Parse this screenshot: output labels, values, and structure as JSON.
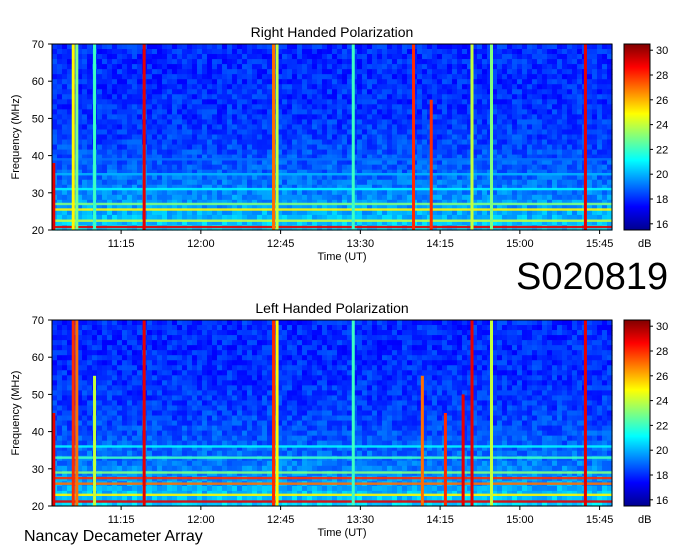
{
  "dataset_code": "S020819",
  "instrument": "Nancay Decameter Array",
  "colorbar": {
    "unit": "dB",
    "range": [
      15.5,
      30.5
    ],
    "ticks": [
      "16",
      "18",
      "20",
      "22",
      "24",
      "26",
      "28",
      "30"
    ]
  },
  "chart_data": [
    {
      "type": "heatmap",
      "title": "Right Handed Polarization",
      "xlabel": "Time (UT)",
      "ylabel": "Frequency (MHz)",
      "xlim": [
        "10:36",
        "15:52"
      ],
      "ylim": [
        20,
        70
      ],
      "x_ticks": [
        "11:15",
        "12:00",
        "12:45",
        "13:30",
        "14:15",
        "15:00",
        "15:45"
      ],
      "y_ticks": [
        "20",
        "30",
        "40",
        "50",
        "60",
        "70"
      ],
      "z_unit": "dB",
      "z_range": [
        15.5,
        30.5
      ],
      "bursts": [
        {
          "time": "10:37",
          "f_low": 20,
          "f_high": 38,
          "level_db": 29
        },
        {
          "time": "10:48",
          "f_low": 20,
          "f_high": 70,
          "level_db": 25
        },
        {
          "time": "10:50",
          "f_low": 20,
          "f_high": 70,
          "level_db": 23
        },
        {
          "time": "11:00",
          "f_low": 20,
          "f_high": 70,
          "level_db": 22
        },
        {
          "time": "11:28",
          "f_low": 20,
          "f_high": 70,
          "level_db": 29
        },
        {
          "time": "12:41",
          "f_low": 20,
          "f_high": 70,
          "level_db": 27
        },
        {
          "time": "12:43",
          "f_low": 20,
          "f_high": 70,
          "level_db": 24
        },
        {
          "time": "13:26",
          "f_low": 20,
          "f_high": 70,
          "level_db": 22
        },
        {
          "time": "14:00",
          "f_low": 20,
          "f_high": 70,
          "level_db": 28
        },
        {
          "time": "14:10",
          "f_low": 20,
          "f_high": 55,
          "level_db": 28
        },
        {
          "time": "14:33",
          "f_low": 20,
          "f_high": 70,
          "level_db": 24
        },
        {
          "time": "14:44",
          "f_low": 20,
          "f_high": 70,
          "level_db": 23
        },
        {
          "time": "15:37",
          "f_low": 20,
          "f_high": 70,
          "level_db": 29
        }
      ],
      "bands": [
        {
          "freq": 20.8,
          "level_db": 29
        },
        {
          "freq": 22.5,
          "level_db": 24
        },
        {
          "freq": 25.5,
          "level_db": 25
        },
        {
          "freq": 27,
          "level_db": 23
        },
        {
          "freq": 31,
          "level_db": 21
        },
        {
          "freq": 35,
          "level_db": 20
        },
        {
          "freq": 39,
          "level_db": 19
        }
      ]
    },
    {
      "type": "heatmap",
      "title": "Left Handed Polarization",
      "xlabel": "Time (UT)",
      "ylabel": "Frequency (MHz)",
      "xlim": [
        "10:36",
        "15:52"
      ],
      "ylim": [
        20,
        70
      ],
      "x_ticks": [
        "11:15",
        "12:00",
        "12:45",
        "13:30",
        "14:15",
        "15:00",
        "15:45"
      ],
      "y_ticks": [
        "20",
        "30",
        "40",
        "50",
        "60",
        "70"
      ],
      "z_unit": "dB",
      "z_range": [
        15.5,
        30.5
      ],
      "bursts": [
        {
          "time": "10:37",
          "f_low": 20,
          "f_high": 45,
          "level_db": 29
        },
        {
          "time": "10:48",
          "f_low": 20,
          "f_high": 70,
          "level_db": 28
        },
        {
          "time": "10:50",
          "f_low": 20,
          "f_high": 70,
          "level_db": 27
        },
        {
          "time": "11:00",
          "f_low": 20,
          "f_high": 55,
          "level_db": 24
        },
        {
          "time": "11:28",
          "f_low": 20,
          "f_high": 70,
          "level_db": 29
        },
        {
          "time": "12:41",
          "f_low": 20,
          "f_high": 70,
          "level_db": 28
        },
        {
          "time": "12:43",
          "f_low": 20,
          "f_high": 70,
          "level_db": 25
        },
        {
          "time": "13:26",
          "f_low": 20,
          "f_high": 70,
          "level_db": 22
        },
        {
          "time": "14:05",
          "f_low": 20,
          "f_high": 55,
          "level_db": 27
        },
        {
          "time": "14:18",
          "f_low": 20,
          "f_high": 45,
          "level_db": 28
        },
        {
          "time": "14:28",
          "f_low": 20,
          "f_high": 50,
          "level_db": 29
        },
        {
          "time": "14:33",
          "f_low": 20,
          "f_high": 70,
          "level_db": 29
        },
        {
          "time": "14:44",
          "f_low": 20,
          "f_high": 70,
          "level_db": 24
        },
        {
          "time": "15:37",
          "f_low": 20,
          "f_high": 70,
          "level_db": 29
        }
      ],
      "bands": [
        {
          "freq": 21.2,
          "level_db": 29
        },
        {
          "freq": 23,
          "level_db": 25
        },
        {
          "freq": 26,
          "level_db": 27
        },
        {
          "freq": 27.5,
          "level_db": 28
        },
        {
          "freq": 29,
          "level_db": 23
        },
        {
          "freq": 33,
          "level_db": 22
        },
        {
          "freq": 36,
          "level_db": 21
        }
      ]
    }
  ]
}
